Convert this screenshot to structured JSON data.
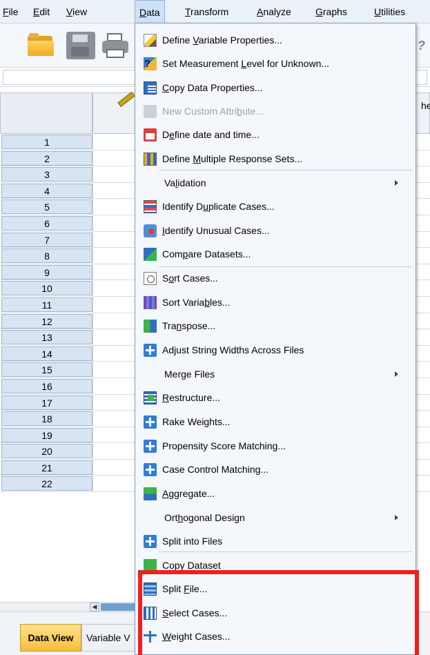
{
  "menubar": {
    "items": [
      {
        "label": "File",
        "key": "F",
        "rest": "ile"
      },
      {
        "label": "Edit",
        "key": "E",
        "rest": "dit"
      },
      {
        "label": "View",
        "key": "V",
        "rest": "iew"
      },
      {
        "label": "Data",
        "key": "D",
        "rest": "ata"
      },
      {
        "label": "Transform",
        "key": "T",
        "rest": "ransform"
      },
      {
        "label": "Analyze",
        "key": "A",
        "rest": "nalyze"
      },
      {
        "label": "Graphs",
        "key": "G",
        "rest": "raphs"
      },
      {
        "label": "Utilities",
        "key": "U",
        "rest": "tilities"
      }
    ],
    "active": "Data"
  },
  "grid": {
    "partial_column_header": "he",
    "row_numbers": [
      "1",
      "2",
      "3",
      "4",
      "5",
      "6",
      "7",
      "8",
      "9",
      "10",
      "11",
      "12",
      "13",
      "14",
      "15",
      "16",
      "17",
      "18",
      "19",
      "20",
      "21",
      "22"
    ]
  },
  "tabs": {
    "data_view": "Data View",
    "variable_view": "Variable V"
  },
  "data_menu": {
    "items": [
      {
        "pre": "Define ",
        "key": "V",
        "post": "ariable Properties...",
        "icon": "pencil-icon",
        "submenu": false,
        "disabled": false
      },
      {
        "pre": "Set Measurement ",
        "key": "L",
        "post": "evel for Unknown...",
        "icon": "measure-level-icon",
        "submenu": false,
        "disabled": false
      },
      {
        "pre": "",
        "key": "C",
        "post": "opy Data Properties...",
        "icon": "copy-properties-icon",
        "submenu": false,
        "disabled": false
      },
      {
        "pre": "New Custom Attri",
        "key": "b",
        "post": "ute...",
        "icon": "custom-attribute-icon",
        "submenu": false,
        "disabled": true
      },
      {
        "pre": "D",
        "key": "e",
        "post": "fine date and time...",
        "icon": "date-icon",
        "submenu": false,
        "disabled": false
      },
      {
        "pre": "Define ",
        "key": "M",
        "post": "ultiple Response Sets...",
        "icon": "multiple-response-icon",
        "submenu": false,
        "disabled": false
      },
      {
        "pre": "Va",
        "key": "l",
        "post": "idation",
        "icon": "",
        "submenu": true,
        "disabled": false
      },
      {
        "pre": "Identify D",
        "key": "u",
        "post": "plicate Cases...",
        "icon": "duplicate-cases-icon",
        "submenu": false,
        "disabled": false
      },
      {
        "pre": "",
        "key": "I",
        "post": "dentify Unusual Cases...",
        "icon": "unusual-cases-icon",
        "submenu": false,
        "disabled": false
      },
      {
        "pre": "Com",
        "key": "p",
        "post": "are Datasets...",
        "icon": "compare-datasets-icon",
        "submenu": false,
        "disabled": false
      },
      {
        "pre": "S",
        "key": "o",
        "post": "rt Cases...",
        "icon": "sort-cases-icon",
        "submenu": false,
        "disabled": false
      },
      {
        "pre": "Sort Varia",
        "key": "b",
        "post": "les...",
        "icon": "sort-variables-icon",
        "submenu": false,
        "disabled": false
      },
      {
        "pre": "Tra",
        "key": "n",
        "post": "spose...",
        "icon": "transpose-icon",
        "submenu": false,
        "disabled": false
      },
      {
        "pre": "Adjust String Widths Across Files",
        "key": "",
        "post": "",
        "icon": "plus-icon",
        "submenu": false,
        "disabled": false
      },
      {
        "pre": "Mer",
        "key": "g",
        "post": "e Files",
        "icon": "",
        "submenu": true,
        "disabled": false
      },
      {
        "pre": "",
        "key": "R",
        "post": "estructure...",
        "icon": "restructure-icon",
        "submenu": false,
        "disabled": false
      },
      {
        "pre": "Rake Weights...",
        "key": "",
        "post": "",
        "icon": "plus-icon",
        "submenu": false,
        "disabled": false
      },
      {
        "pre": "Propensity Score Matching...",
        "key": "",
        "post": "",
        "icon": "plus-icon",
        "submenu": false,
        "disabled": false
      },
      {
        "pre": "Case Control Matching...",
        "key": "",
        "post": "",
        "icon": "plus-icon",
        "submenu": false,
        "disabled": false
      },
      {
        "pre": "",
        "key": "A",
        "post": "ggregate...",
        "icon": "aggregate-icon",
        "submenu": false,
        "disabled": false
      },
      {
        "pre": "Ort",
        "key": "h",
        "post": "ogonal Design",
        "icon": "",
        "submenu": true,
        "disabled": false
      },
      {
        "pre": "Split into Files",
        "key": "",
        "post": "",
        "icon": "plus-icon",
        "submenu": false,
        "disabled": false
      },
      {
        "pre": "Copy Dataset",
        "key": "",
        "post": "",
        "icon": "copy-dataset-icon",
        "submenu": false,
        "disabled": false
      },
      {
        "pre": "Split ",
        "key": "F",
        "post": "ile...",
        "icon": "split-file-icon",
        "submenu": false,
        "disabled": false
      },
      {
        "pre": "",
        "key": "S",
        "post": "elect Cases...",
        "icon": "select-cases-icon",
        "submenu": false,
        "disabled": false
      },
      {
        "pre": "",
        "key": "W",
        "post": "eight Cases...",
        "icon": "weight-cases-icon",
        "submenu": false,
        "disabled": false
      }
    ]
  },
  "colors": {
    "highlight": "#f02020",
    "data_view_tab": "#f6be3d",
    "menu_background": "#f4f7fb"
  }
}
